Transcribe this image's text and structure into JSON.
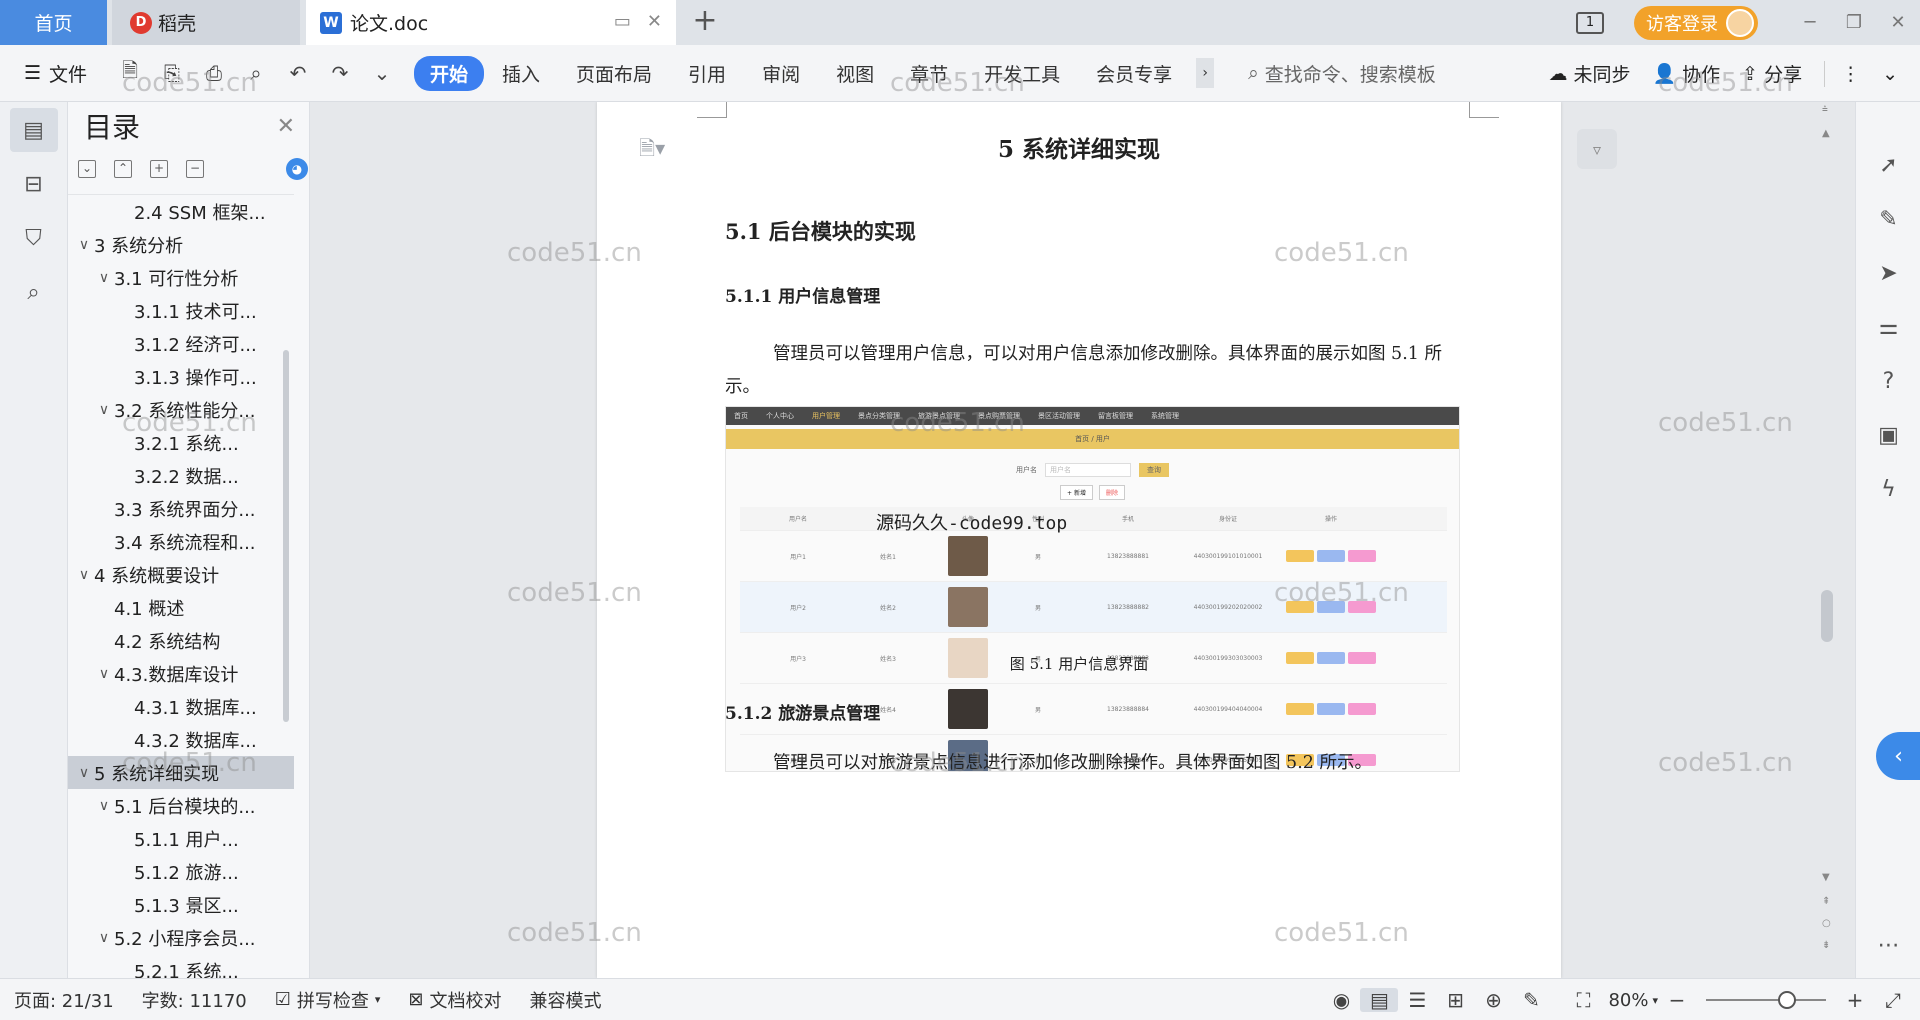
{
  "titlebar": {
    "home_tab": "首页",
    "daoke_tab": "稻壳",
    "doc_tab": "论文.doc",
    "window_count": "1",
    "login_label": "访客登录"
  },
  "toolbar": {
    "file_label": "文件",
    "tabs": [
      "开始",
      "插入",
      "页面布局",
      "引用",
      "审阅",
      "视图",
      "章节",
      "开发工具",
      "会员专享"
    ],
    "search_placeholder": "查找命令、搜索模板",
    "sync_label": "未同步",
    "collab_label": "协作",
    "share_label": "分享"
  },
  "toc": {
    "title": "目录",
    "items": [
      {
        "label": "2.4 SSM 框架...",
        "level": 3,
        "caret": ""
      },
      {
        "label": "3 系统分析",
        "level": 1,
        "caret": "∨"
      },
      {
        "label": "3.1 可行性分析",
        "level": 2,
        "caret": "∨"
      },
      {
        "label": "3.1.1 技术可...",
        "level": 3,
        "caret": ""
      },
      {
        "label": "3.1.2 经济可...",
        "level": 3,
        "caret": ""
      },
      {
        "label": "3.1.3 操作可...",
        "level": 3,
        "caret": ""
      },
      {
        "label": "3.2 系统性能分...",
        "level": 2,
        "caret": "∨"
      },
      {
        "label": "3.2.1 系统...",
        "level": 3,
        "caret": ""
      },
      {
        "label": "3.2.2 数据...",
        "level": 3,
        "caret": ""
      },
      {
        "label": "3.3 系统界面分...",
        "level": 2,
        "caret": ""
      },
      {
        "label": "3.4 系统流程和...",
        "level": 2,
        "caret": ""
      },
      {
        "label": "4 系统概要设计",
        "level": 1,
        "caret": "∨"
      },
      {
        "label": "4.1 概述",
        "level": 2,
        "caret": ""
      },
      {
        "label": "4.2 系统结构",
        "level": 2,
        "caret": ""
      },
      {
        "label": "4.3.数据库设计",
        "level": 2,
        "caret": "∨"
      },
      {
        "label": "4.3.1 数据库...",
        "level": 3,
        "caret": ""
      },
      {
        "label": "4.3.2 数据库...",
        "level": 3,
        "caret": ""
      },
      {
        "label": "5 系统详细实现",
        "level": 1,
        "caret": "∨",
        "selected": true
      },
      {
        "label": "5.1 后台模块的...",
        "level": 2,
        "caret": "∨"
      },
      {
        "label": "5.1.1 用户...",
        "level": 3,
        "caret": ""
      },
      {
        "label": "5.1.2 旅游...",
        "level": 3,
        "caret": ""
      },
      {
        "label": "5.1.3 景区...",
        "level": 3,
        "caret": ""
      },
      {
        "label": "5.2 小程序会员...",
        "level": 2,
        "caret": "∨"
      },
      {
        "label": "5.2.1 系统...",
        "level": 3,
        "caret": ""
      }
    ]
  },
  "document": {
    "chapter_title": "5 系统详细实现",
    "section_title": "5.1  后台模块的实现",
    "sub1_title": "5.1.1  用户信息管理",
    "para1": "管理员可以管理用户信息，可以对用户信息添加修改删除。具体界面的展示如图 5.1 所示。",
    "figure_caption": "图 5.1  用户信息界面",
    "sub2_title": "5.1.2  旅游景点管理",
    "para2": "管理员可以对旅游景点信息进行添加修改删除操作。具体界面如图 5.2 所示。",
    "figure": {
      "nav": [
        "首页",
        "个人中心",
        "用户管理",
        "景点分类管理",
        "旅游景点管理",
        "景点购票管理",
        "景区活动管理",
        "留言板管理",
        "系统管理"
      ],
      "breadcrumb": "首页 / 用户",
      "search_label": "用户名",
      "search_placeholder": "用户名",
      "search_btn": "查询",
      "add_btn": "+ 新增",
      "del_btn": "删除",
      "headers": [
        "",
        "用户名",
        "姓名",
        "头像",
        "性别",
        "手机",
        "身份证",
        "操作"
      ],
      "rows": [
        [
          "用户1",
          "姓名1",
          "男",
          "13823888881",
          "440300199101010001"
        ],
        [
          "用户2",
          "姓名2",
          "男",
          "13823888882",
          "440300199202020002"
        ],
        [
          "用户3",
          "姓名3",
          "男",
          "13823888883",
          "440300199303030003"
        ],
        [
          "用户4",
          "姓名4",
          "男",
          "13823888884",
          "440300199404040004"
        ],
        [
          "用户5",
          "姓名5",
          "男",
          "13823888885",
          "440300199505050005"
        ]
      ],
      "overlay_text": "源码久久-code99.top"
    }
  },
  "watermark": "code51.cn",
  "status": {
    "page": "页面: 21/31",
    "words": "字数: 11170",
    "spell": "拼写检查",
    "proof": "文档校对",
    "compat": "兼容模式",
    "zoom": "80%"
  }
}
